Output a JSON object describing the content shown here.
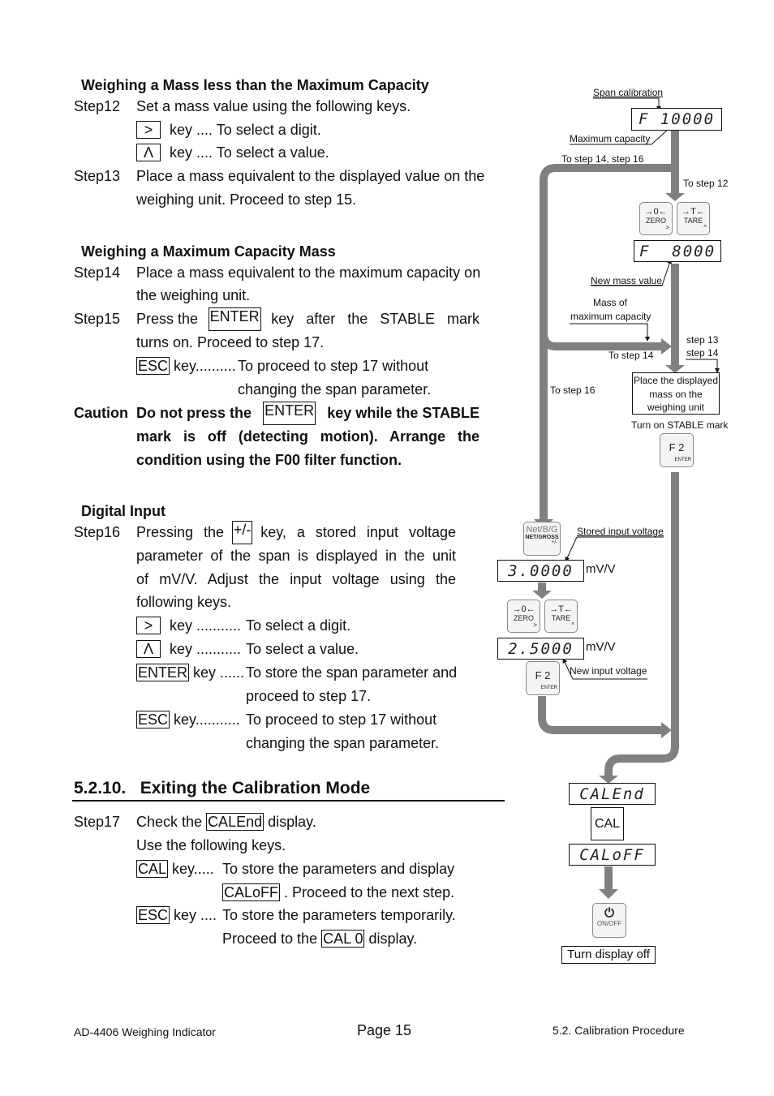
{
  "section_a": {
    "title": "Weighing a Mass less than the Maximum Capacity",
    "step12": {
      "label": "Step12",
      "text": "Set a mass value using the following keys."
    },
    "keys12": [
      {
        "key": ">",
        "desc": "key .... To select a digit."
      },
      {
        "key": "Λ",
        "desc": "key .... To select a value."
      }
    ],
    "step13": {
      "label": "Step13",
      "line1": "Place a mass equivalent to the displayed value on the",
      "line2": "weighing unit. Proceed to step 15."
    }
  },
  "section_b": {
    "title": "Weighing a Maximum Capacity Mass",
    "step14": {
      "label": "Step14",
      "line1": "Place a mass equivalent to the maximum capacity on",
      "line2": "the weighing unit."
    },
    "step15": {
      "label": "Step15",
      "pre": "Press the",
      "key": "ENTER",
      "post": "key after the STABLE mark",
      "line2": "turns on. Proceed to step 17."
    },
    "esc": {
      "key": "ESC",
      "dots": "key..........",
      "line1": "To proceed to step 17 without",
      "line2": "changing the span parameter."
    },
    "caution": {
      "label": "Caution",
      "pre": "Do not press the",
      "key": "ENTER",
      "post": "key while the STABLE",
      "line2": "mark is off (detecting motion). Arrange the",
      "line3": "condition using the F00 filter function."
    }
  },
  "section_c": {
    "title": "Digital Input",
    "step16": {
      "label": "Step16",
      "pre": "Pressing the",
      "key": "+/-",
      "post": "key, a stored input voltage",
      "line2": "parameter of the span is displayed in the unit",
      "line3": "of mV/V. Adjust the input voltage using the",
      "line4": "following keys."
    },
    "keys16": [
      {
        "key": ">",
        "dots": "key ...........",
        "line1": "To select a digit.",
        "line2": ""
      },
      {
        "key": "Λ",
        "dots": "key ...........",
        "line1": "To select a value.",
        "line2": ""
      },
      {
        "key": "ENTER",
        "dots": "key ......",
        "line1": "To store the span parameter and",
        "line2": "proceed to step 17."
      },
      {
        "key": "ESC",
        "dots": "key...........",
        "line1": "To proceed to step 17 without",
        "line2": "changing the span parameter."
      }
    ]
  },
  "section_d": {
    "heading": "5.2.10.   Exiting the Calibration Mode",
    "step17": {
      "label": "Step17",
      "pre": "Check the",
      "key": "CALEnd",
      "post": "display.",
      "line2": "Use the following keys."
    },
    "cal": {
      "key": "CAL",
      "dots": "key.....",
      "line1": "To store the parameters and display",
      "key2": "CALoFF",
      "line2": ". Proceed to the next step."
    },
    "esc": {
      "key": "ESC",
      "dots": "key ....",
      "line1": "To store the parameters temporarily.",
      "pre2": "Proceed to the",
      "key2": "CAL 0",
      "post2": "display."
    }
  },
  "diagram": {
    "span_calibration": "Span calibration",
    "display1": "F 10000",
    "maximum_capacity": "Maximum capacity",
    "to_step_14_16": "To step 14, step 16",
    "to_step_12": "To step 12",
    "zero_key": {
      "symbol": "→0←",
      "label": "ZERO",
      "sub": ">"
    },
    "tare_key": {
      "symbol": "→T←",
      "label": "TARE",
      "sub": "^"
    },
    "display2": "F  8000",
    "new_mass_value": "New mass value",
    "mass_of_max_1": "Mass of",
    "mass_of_max_2": "maximum capacity",
    "to_step_14": "To step 14",
    "step13_label": "step 13",
    "step14_label": "step 14",
    "to_step_16": "To step 16",
    "place_box": [
      "Place the displayed",
      "mass on the",
      "weighing unit"
    ],
    "turn_on_stable": "Turn on STABLE mark",
    "f2_key": {
      "label": "F 2",
      "sub": "ENTER"
    },
    "netgross_key": {
      "top": "Net/B/G",
      "mid": "NET/GROSS",
      "sub": "+/-"
    },
    "stored_input_voltage": "Stored input voltage",
    "display3": "3.0000",
    "unit": "mV/V",
    "display4": "2.5000",
    "new_input_voltage": "New input voltage",
    "display_calend": "CALEnd",
    "cal_key": "CAL",
    "display_caloff": "CALoFF",
    "onoff_key": {
      "symbol": "⏻",
      "label": "ON/OFF"
    },
    "turn_display_off": "Turn display off"
  },
  "footer": {
    "left": "AD-4406 Weighing Indicator",
    "center": "Page 15",
    "right": "5.2. Calibration Procedure"
  }
}
